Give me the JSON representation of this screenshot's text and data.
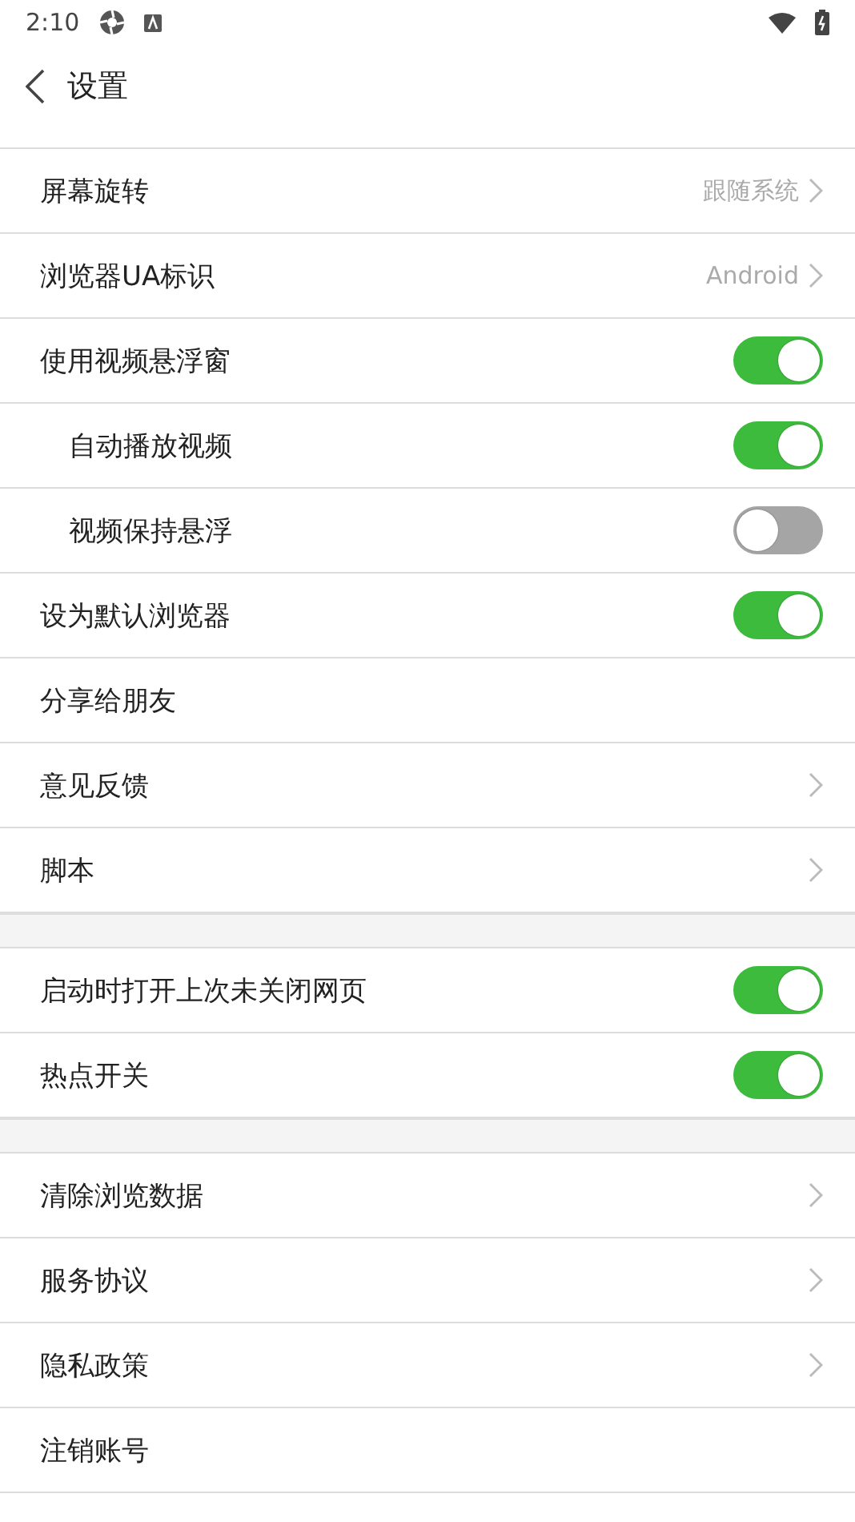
{
  "status_bar": {
    "time": "2:10"
  },
  "header": {
    "title": "设置"
  },
  "sections": [
    {
      "items": [
        {
          "kind": "select",
          "label": "屏幕旋转",
          "value": "跟随系统"
        },
        {
          "kind": "select",
          "label": "浏览器UA标识",
          "value": "Android"
        },
        {
          "kind": "toggle",
          "label": "使用视频悬浮窗",
          "on": true,
          "children": [
            {
              "kind": "toggle",
              "label": "自动播放视频",
              "on": true
            },
            {
              "kind": "toggle",
              "label": "视频保持悬浮",
              "on": false
            }
          ]
        },
        {
          "kind": "toggle",
          "label": "设为默认浏览器",
          "on": true
        },
        {
          "kind": "plain",
          "label": "分享给朋友"
        },
        {
          "kind": "link",
          "label": "意见反馈"
        },
        {
          "kind": "link",
          "label": "脚本"
        }
      ]
    },
    {
      "items": [
        {
          "kind": "toggle",
          "label": "启动时打开上次未关闭网页",
          "on": true
        },
        {
          "kind": "toggle",
          "label": "热点开关",
          "on": true
        }
      ]
    },
    {
      "items": [
        {
          "kind": "link",
          "label": "清除浏览数据"
        },
        {
          "kind": "link",
          "label": "服务协议"
        },
        {
          "kind": "link",
          "label": "隐私政策"
        },
        {
          "kind": "plain",
          "label": "注销账号"
        }
      ]
    }
  ]
}
